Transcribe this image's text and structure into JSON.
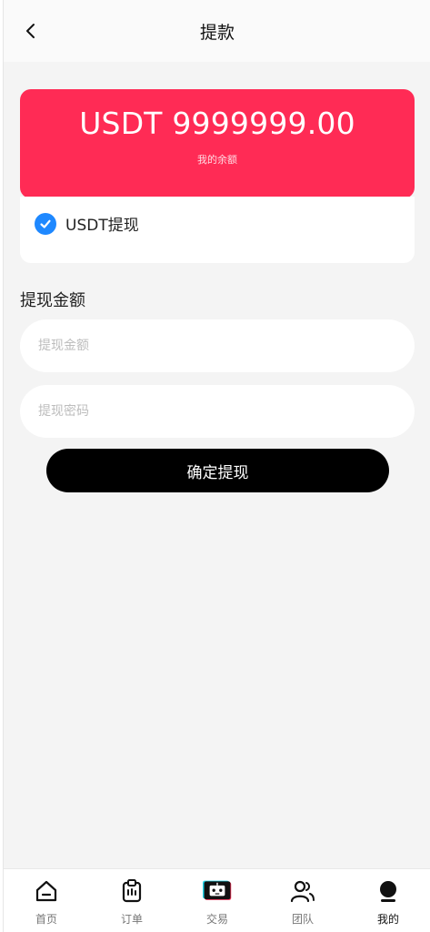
{
  "header": {
    "title": "提款",
    "back_icon": "chevron-left-icon"
  },
  "balance": {
    "amount": "USDT 9999999.00",
    "label": "我的余额",
    "card_color": "#ff2b55"
  },
  "method": {
    "label": "USDT提现",
    "checked": true,
    "check_color": "#1e88ff"
  },
  "form": {
    "section_title": "提现金额",
    "amount_placeholder": "提现金额",
    "password_placeholder": "提现密码",
    "amount_value": "",
    "password_value": "",
    "submit_label": "确定提现"
  },
  "nav": {
    "items": [
      {
        "label": "首页",
        "icon": "home-icon",
        "active": false
      },
      {
        "label": "订单",
        "icon": "clipboard-icon",
        "active": false
      },
      {
        "label": "交易",
        "icon": "robot-icon",
        "active": false
      },
      {
        "label": "团队",
        "icon": "team-icon",
        "active": false
      },
      {
        "label": "我的",
        "icon": "user-icon",
        "active": true
      }
    ]
  }
}
